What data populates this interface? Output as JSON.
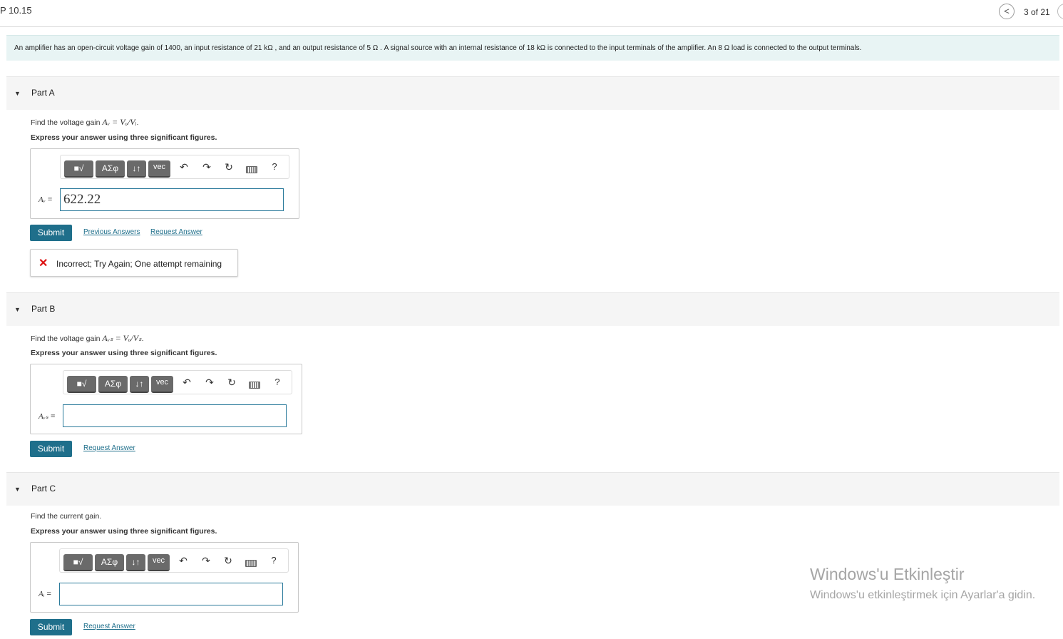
{
  "header": {
    "problem_title": "P 10.15",
    "nav_prev_icon": "chevron-left-icon",
    "nav_count": "3 of 21"
  },
  "problem": {
    "statement": "An amplifier has an open-circuit voltage gain of 1400, an input resistance of 21  kΩ , and an output resistance of 5  Ω . A signal source with an internal resistance of 18  kΩ is connected to the input terminals of the amplifier. An 8  Ω load is connected to the output terminals."
  },
  "toolbar": {
    "templates_label": "■√",
    "greek_label": "ΑΣφ",
    "arrows_label": "↓↑",
    "vec_label": "vec",
    "undo_icon": "undo-icon",
    "redo_icon": "redo-icon",
    "reset_icon": "reset-icon",
    "keyboard_icon": "keyboard-icon",
    "help_label": "?"
  },
  "part_a": {
    "label": "Part A",
    "question_prefix": "Find the voltage gain ",
    "question_math": "Aᵥ = Vₒ/Vᵢ",
    "question_suffix": ".",
    "hint": "Express your answer using three significant figures.",
    "var_label": "Aᵥ",
    "eq": " =",
    "input_value": "622.22",
    "submit_label": "Submit",
    "previous_answers_label": "Previous Answers",
    "request_answer_label": "Request Answer",
    "feedback_icon": "x-icon",
    "feedback_text": "Incorrect; Try Again; One attempt remaining"
  },
  "part_b": {
    "label": "Part B",
    "question_prefix": "Find the voltage gain ",
    "question_math": "Aᵥₛ = Vₒ/Vₛ",
    "question_suffix": ".",
    "hint": "Express your answer using three significant figures.",
    "var_label": "Aᵥₛ",
    "eq": " =",
    "input_value": "",
    "submit_label": "Submit",
    "request_answer_label": "Request Answer"
  },
  "part_c": {
    "label": "Part C",
    "question_prefix": "Find the current gain.",
    "hint": "Express your answer using three significant figures.",
    "var_label": "Aᵢ",
    "eq": " =",
    "input_value": "",
    "submit_label": "Submit",
    "request_answer_label": "Request Answer"
  },
  "watermark": {
    "title": "Windows'u Etkinleştir",
    "subtitle": "Windows'u etkinleştirmek için Ayarlar'a gidin."
  }
}
